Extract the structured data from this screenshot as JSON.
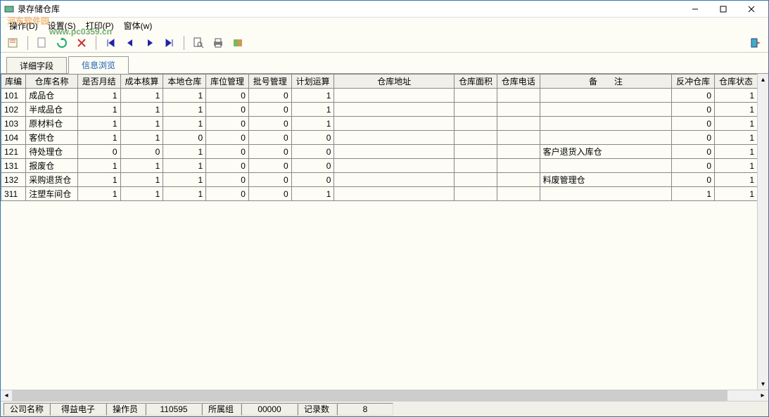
{
  "window": {
    "title": "录存储仓库"
  },
  "watermark": {
    "main": "河东软件园",
    "sub": "www.pc0359.cn"
  },
  "menu": {
    "file": "操作(D)",
    "setting": "设置(S)",
    "print": "打印(P)",
    "window": "窗体(w)"
  },
  "tabs": {
    "detail": "详细字段",
    "browse": "信息浏览"
  },
  "columns": [
    "库编",
    "仓库名称",
    "是否月结",
    "成本核算",
    "本地仓库",
    "库位管理",
    "批号管理",
    "计划运算",
    "仓库地址",
    "仓库面积",
    "仓库电话",
    "备　　注",
    "反冲仓库",
    "仓库状态"
  ],
  "rows": [
    {
      "id": "101",
      "name": "成品仓",
      "c": [
        "1",
        "1",
        "1",
        "0",
        "0",
        "1"
      ],
      "addr": "",
      "area": "",
      "tel": "",
      "note": "",
      "rev": "0",
      "stat": "1"
    },
    {
      "id": "102",
      "name": "半成品仓",
      "c": [
        "1",
        "1",
        "1",
        "0",
        "0",
        "1"
      ],
      "addr": "",
      "area": "",
      "tel": "",
      "note": "",
      "rev": "0",
      "stat": "1"
    },
    {
      "id": "103",
      "name": "原材料仓",
      "c": [
        "1",
        "1",
        "1",
        "0",
        "0",
        "1"
      ],
      "addr": "",
      "area": "",
      "tel": "",
      "note": "",
      "rev": "0",
      "stat": "1"
    },
    {
      "id": "104",
      "name": "客供仓",
      "c": [
        "1",
        "1",
        "0",
        "0",
        "0",
        "0"
      ],
      "addr": "",
      "area": "",
      "tel": "",
      "note": "",
      "rev": "0",
      "stat": "1"
    },
    {
      "id": "121",
      "name": "待处理仓",
      "c": [
        "0",
        "0",
        "1",
        "0",
        "0",
        "0"
      ],
      "addr": "",
      "area": "",
      "tel": "",
      "note": "客户退货入库仓",
      "rev": "0",
      "stat": "1"
    },
    {
      "id": "131",
      "name": "报废仓",
      "c": [
        "1",
        "1",
        "1",
        "0",
        "0",
        "0"
      ],
      "addr": "",
      "area": "",
      "tel": "",
      "note": "",
      "rev": "0",
      "stat": "1"
    },
    {
      "id": "132",
      "name": "采购退货仓",
      "c": [
        "1",
        "1",
        "1",
        "0",
        "0",
        "0"
      ],
      "addr": "",
      "area": "",
      "tel": "",
      "note": "料废管理仓",
      "rev": "0",
      "stat": "1"
    },
    {
      "id": "311",
      "name": "注塑车间仓",
      "c": [
        "1",
        "1",
        "1",
        "0",
        "0",
        "1"
      ],
      "addr": "",
      "area": "",
      "tel": "",
      "note": "",
      "rev": "1",
      "stat": "1"
    }
  ],
  "status": {
    "company_label": "公司名称",
    "company_val": "得益电子",
    "operator_label": "操作员",
    "operator_val": "110595",
    "group_label": "所属组",
    "group_val": "00000",
    "count_label": "记录数",
    "count_val": "8"
  }
}
